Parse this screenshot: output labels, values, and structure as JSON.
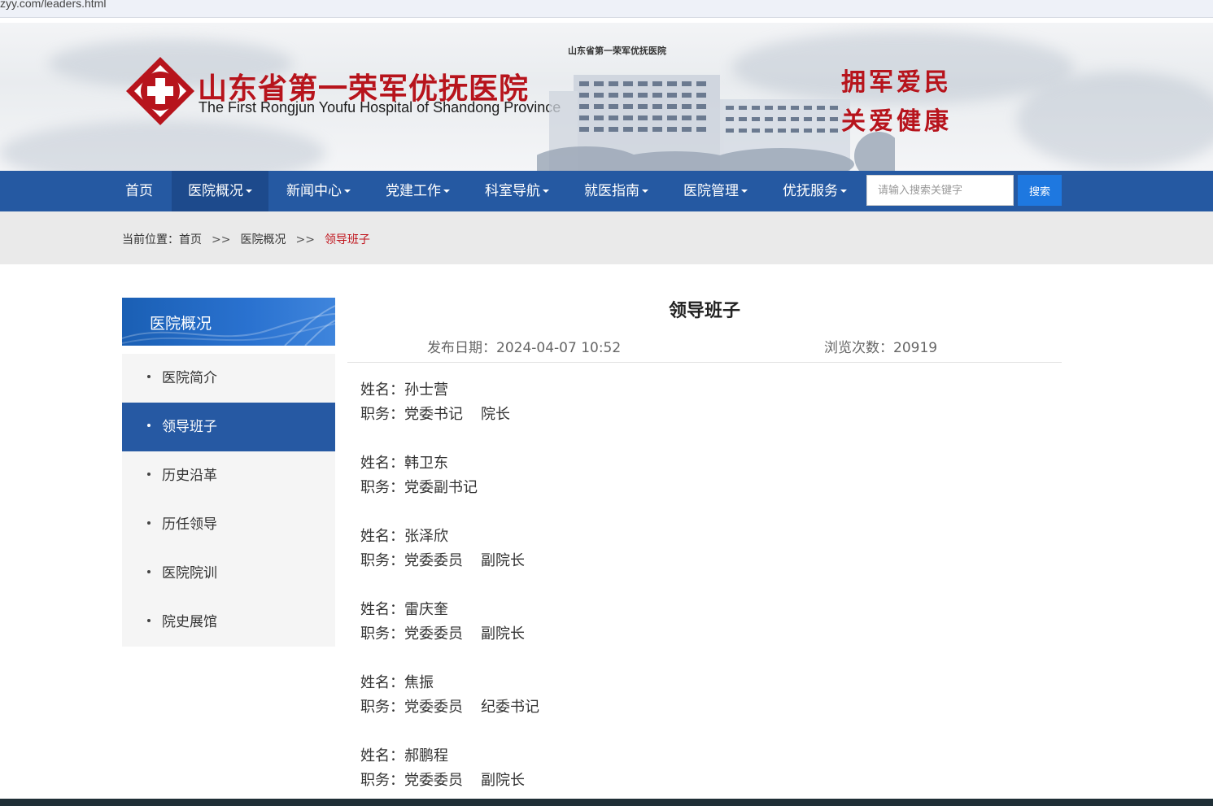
{
  "browser": {
    "url": "zyy.com/leaders.html"
  },
  "header": {
    "title": "山东省第一荣军优抚医院",
    "subtitle": "The First Rongjun Youfu Hospital of Shandong Province",
    "building_caption": "山东省第一荣军优抚医院",
    "slogan_line1": "拥军爱民",
    "slogan_line2": "关爱健康",
    "brand_red": "#b7141c"
  },
  "nav": {
    "items": [
      {
        "label": "首页"
      },
      {
        "label": "医院概况"
      },
      {
        "label": "新闻中心"
      },
      {
        "label": "党建工作"
      },
      {
        "label": "科室导航"
      },
      {
        "label": "就医指南"
      },
      {
        "label": "医院管理"
      },
      {
        "label": "优抚服务"
      }
    ],
    "search_placeholder": "请输入搜索关键字",
    "search_button": "搜索",
    "nav_color": "#2559a2"
  },
  "breadcrumb": {
    "prefix": "当前位置：",
    "home": "首页",
    "sep": ">>",
    "parent": "医院概况",
    "current": "领导班子"
  },
  "sidebar": {
    "heading": "医院概况",
    "items": [
      {
        "label": "医院简介"
      },
      {
        "label": "领导班子",
        "active": true
      },
      {
        "label": "历史沿革"
      },
      {
        "label": "历任领导"
      },
      {
        "label": "医院院训"
      },
      {
        "label": "院史展馆"
      }
    ]
  },
  "article": {
    "title": "领导班子",
    "date_label": "发布日期：2024-04-07 10:52",
    "views_label": "浏览次数：20919",
    "name_prefix": "姓名：",
    "role_prefix": "职务：",
    "people": [
      {
        "name": "孙士营",
        "role1": "党委书记",
        "role2": "院长"
      },
      {
        "name": "韩卫东",
        "role1": "党委副书记",
        "role2": ""
      },
      {
        "name": "张泽欣",
        "role1": "党委委员",
        "role2": "副院长"
      },
      {
        "name": "雷庆奎",
        "role1": "党委委员",
        "role2": "副院长"
      },
      {
        "name": "焦振",
        "role1": "党委委员",
        "role2": "纪委书记"
      },
      {
        "name": "郝鹏程",
        "role1": "党委委员",
        "role2": "副院长"
      }
    ]
  }
}
